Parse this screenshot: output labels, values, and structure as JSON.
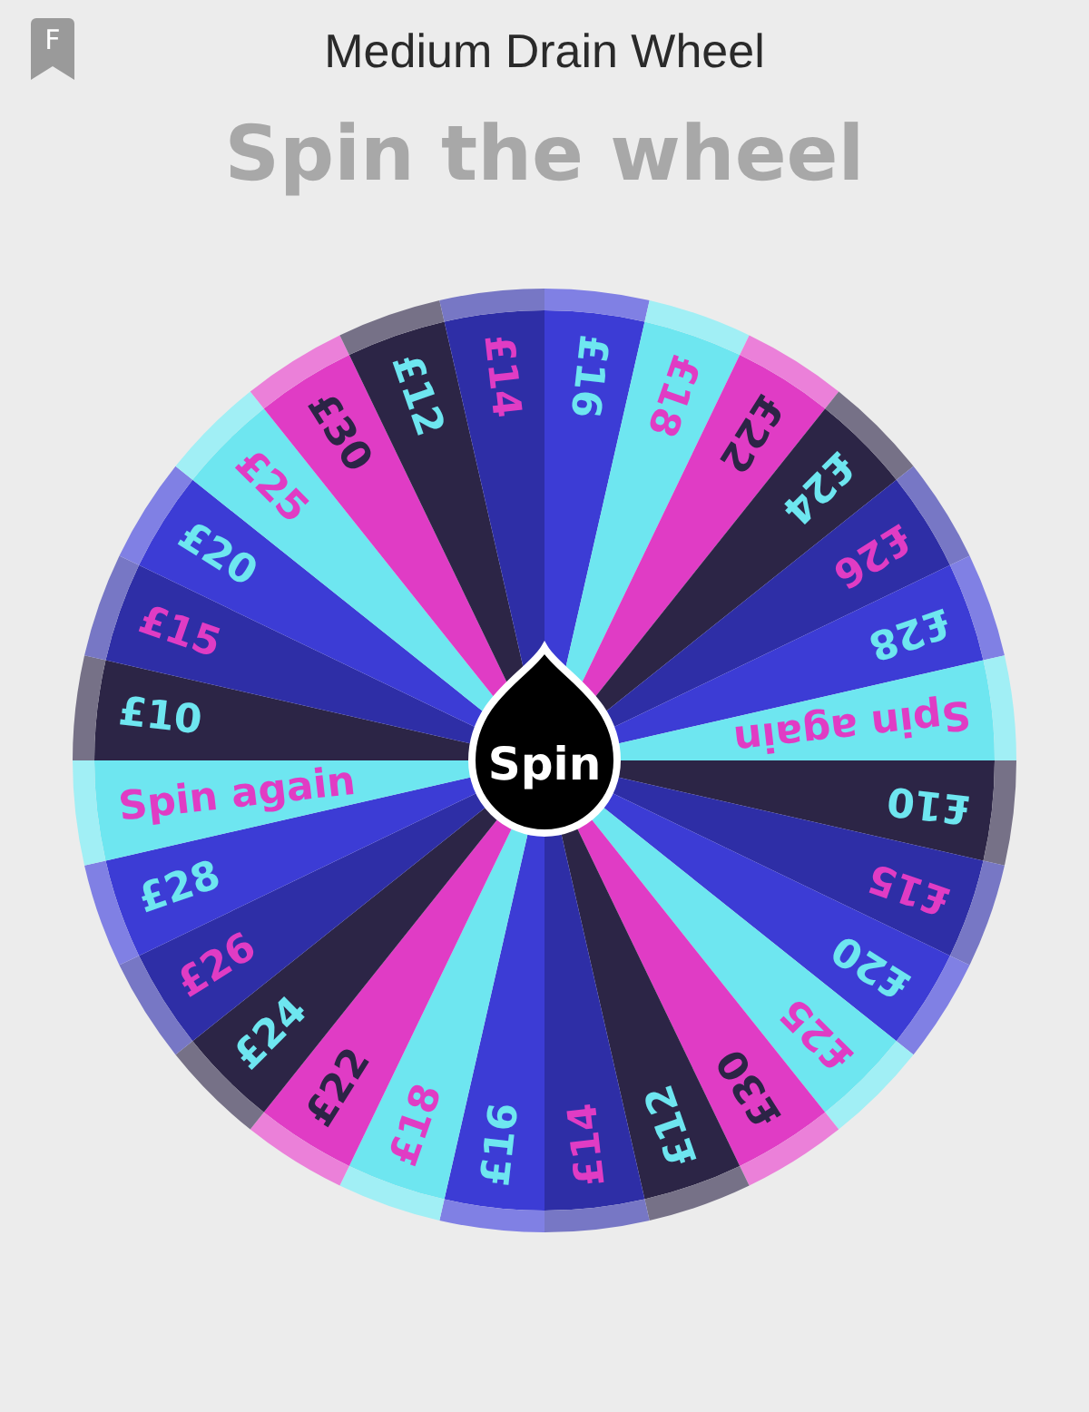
{
  "header": {
    "badge": "F",
    "title": "Medium Drain Wheel"
  },
  "heading": "Spin the wheel",
  "wheel": {
    "button": "Spin",
    "segments": [
      {
        "label": "£16",
        "color": "#8080e4",
        "kind": "cool"
      },
      {
        "label": "£18",
        "color": "#a1eff5",
        "kind": "warm"
      },
      {
        "label": "£22",
        "color": "#eb80d9",
        "kind": "ink"
      },
      {
        "label": "£24",
        "color": "#767187",
        "kind": "cool"
      },
      {
        "label": "£26",
        "color": "#7777c5",
        "kind": "warm"
      },
      {
        "label": "£28",
        "color": "#8080e4",
        "kind": "cool"
      },
      {
        "label": "Spin again",
        "color": "#a1eff5",
        "kind": "warm"
      },
      {
        "label": "£10",
        "color": "#767187",
        "kind": "cool"
      },
      {
        "label": "£15",
        "color": "#7777c5",
        "kind": "warm"
      },
      {
        "label": "£20",
        "color": "#8080e4",
        "kind": "cool"
      },
      {
        "label": "£25",
        "color": "#a1eff5",
        "kind": "warm"
      },
      {
        "label": "£30",
        "color": "#eb80d9",
        "kind": "ink"
      },
      {
        "label": "£12",
        "color": "#767187",
        "kind": "cool"
      },
      {
        "label": "£14",
        "color": "#7777c5",
        "kind": "warm"
      },
      {
        "label": "£16",
        "color": "#8080e4",
        "kind": "cool"
      },
      {
        "label": "£18",
        "color": "#a1eff5",
        "kind": "warm"
      },
      {
        "label": "£22",
        "color": "#eb80d9",
        "kind": "ink"
      },
      {
        "label": "£24",
        "color": "#767187",
        "kind": "cool"
      },
      {
        "label": "£26",
        "color": "#7777c5",
        "kind": "warm"
      },
      {
        "label": "£28",
        "color": "#8080e4",
        "kind": "cool"
      },
      {
        "label": "Spin again",
        "color": "#a1eff5",
        "kind": "warm"
      },
      {
        "label": "£10",
        "color": "#767187",
        "kind": "cool"
      },
      {
        "label": "£15",
        "color": "#7777c5",
        "kind": "warm"
      },
      {
        "label": "£20",
        "color": "#8080e4",
        "kind": "cool"
      },
      {
        "label": "£25",
        "color": "#a1eff5",
        "kind": "warm"
      },
      {
        "label": "£30",
        "color": "#eb80d9",
        "kind": "ink"
      },
      {
        "label": "£12",
        "color": "#767187",
        "kind": "cool"
      },
      {
        "label": "£14",
        "color": "#7777c5",
        "kind": "warm"
      }
    ]
  }
}
